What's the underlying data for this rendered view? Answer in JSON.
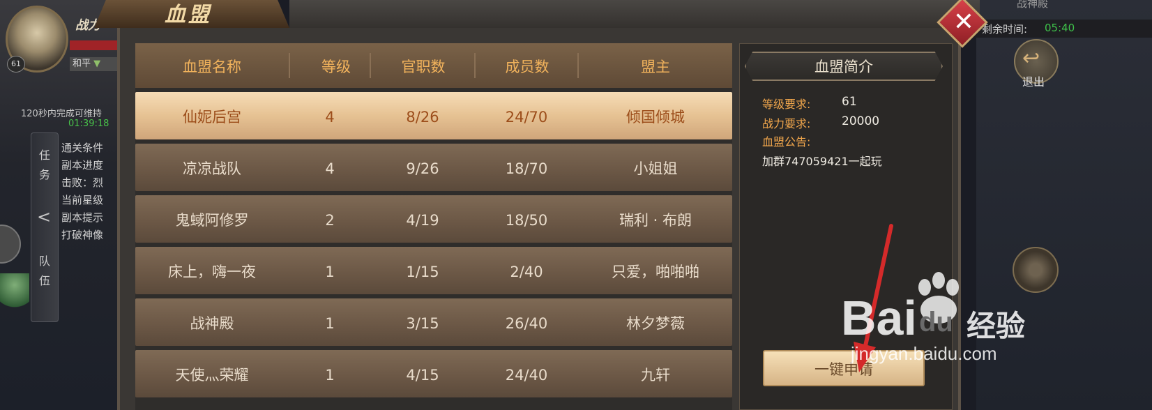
{
  "hud": {
    "level": "61",
    "power_label": "战力",
    "peace_mode": "和平",
    "quest_timer_text": "120秒内完成可维持",
    "quest_timer_value": "01:39:18",
    "side_tab_task": "任务",
    "side_tab_team": "队伍",
    "task_lines": [
      "通关条件",
      "副本进度",
      "击败：烈",
      "当前星级",
      "副本提示",
      "打破神像"
    ],
    "remaining_time_label": "剩余时间:",
    "remaining_time_value": "05:40",
    "top_right_title": "战神殿",
    "exit_label": "退出"
  },
  "dialog": {
    "title": "血盟",
    "close_label": "✕"
  },
  "table": {
    "headers": [
      "血盟名称",
      "等级",
      "官职数",
      "成员数",
      "盟主"
    ],
    "rows": [
      {
        "name": "仙妮后宫",
        "level": "4",
        "posts": "8/26",
        "members": "24/70",
        "leader": "倾国倾城",
        "selected": true
      },
      {
        "name": "凉凉战队",
        "level": "4",
        "posts": "9/26",
        "members": "18/70",
        "leader": "小姐姐",
        "selected": false
      },
      {
        "name": "鬼蜮阿修罗",
        "level": "2",
        "posts": "4/19",
        "members": "18/50",
        "leader": "瑞利 · 布朗",
        "selected": false
      },
      {
        "name": "床上，嗨一夜",
        "level": "1",
        "posts": "1/15",
        "members": "2/40",
        "leader": "只爱，啪啪啪",
        "selected": false
      },
      {
        "name": "战神殿",
        "level": "1",
        "posts": "3/15",
        "members": "26/40",
        "leader": "林夕梦薇",
        "selected": false
      },
      {
        "name": "天使灬荣耀",
        "level": "1",
        "posts": "4/15",
        "members": "24/40",
        "leader": "九轩",
        "selected": false
      }
    ]
  },
  "info": {
    "title": "血盟简介",
    "level_req_label": "等级要求:",
    "level_req_value": "61",
    "power_req_label": "战力要求:",
    "power_req_value": "20000",
    "notice_label": "血盟公告:",
    "notice_text": "加群747059421一起玩",
    "apply_button": "一键申请"
  },
  "watermark": {
    "brand": "Bai",
    "brand_du": "du",
    "brand_cn": "经验",
    "url": "jingyan.baidu.com"
  },
  "colors": {
    "header_text": "#f2b35c",
    "selected_text": "#9c4d1a",
    "label_orange": "#f2a74c",
    "timer_green": "#3ec24a"
  }
}
